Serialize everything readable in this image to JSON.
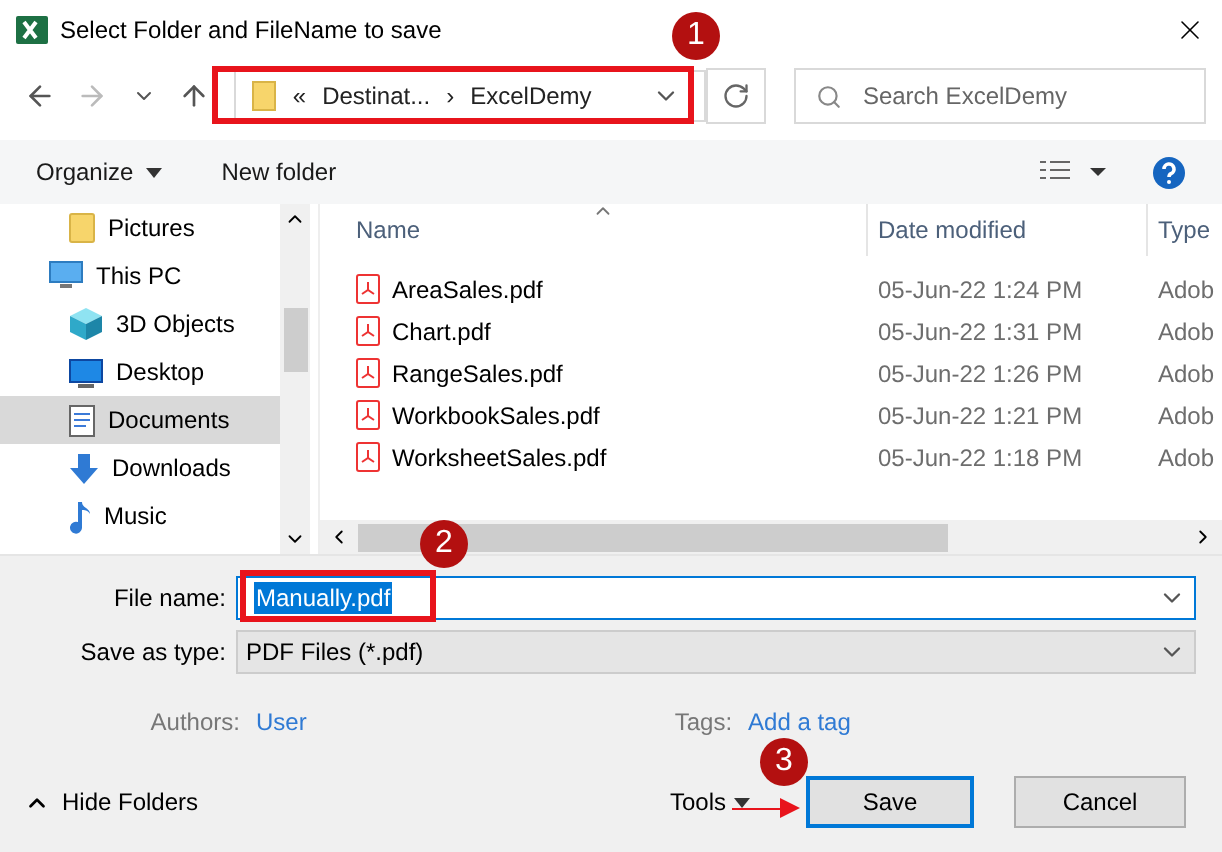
{
  "window": {
    "title": "Select Folder and FileName to save"
  },
  "address": {
    "overflow": "«",
    "segments": [
      "Destinat...",
      "ExcelDemy"
    ],
    "separator": "›"
  },
  "search": {
    "placeholder": "Search ExcelDemy"
  },
  "toolbar": {
    "organize": "Organize",
    "new_folder": "New folder"
  },
  "nav": [
    {
      "label": "Pictures",
      "kind": "folder",
      "selected": false
    },
    {
      "label": "This PC",
      "kind": "pc",
      "selected": false,
      "children": [
        {
          "label": "3D Objects",
          "kind": "cube",
          "selected": false
        },
        {
          "label": "Desktop",
          "kind": "desktop",
          "selected": false
        },
        {
          "label": "Documents",
          "kind": "document",
          "selected": true
        },
        {
          "label": "Downloads",
          "kind": "download",
          "selected": false
        },
        {
          "label": "Music",
          "kind": "music",
          "selected": false
        }
      ]
    }
  ],
  "columns": [
    "Name",
    "Date modified",
    "Type"
  ],
  "rows": [
    {
      "name": "AreaSales.pdf",
      "date": "05-Jun-22 1:24 PM",
      "type": "Adob"
    },
    {
      "name": "Chart.pdf",
      "date": "05-Jun-22 1:31 PM",
      "type": "Adob"
    },
    {
      "name": "RangeSales.pdf",
      "date": "05-Jun-22 1:26 PM",
      "type": "Adob"
    },
    {
      "name": "WorkbookSales.pdf",
      "date": "05-Jun-22 1:21 PM",
      "type": "Adob"
    },
    {
      "name": "WorksheetSales.pdf",
      "date": "05-Jun-22 1:18 PM",
      "type": "Adob"
    }
  ],
  "file_name": {
    "label": "File name:",
    "value": "Manually.pdf"
  },
  "save_type": {
    "label": "Save as type:",
    "value": "PDF Files (*.pdf)"
  },
  "authors": {
    "label": "Authors:",
    "value": "User"
  },
  "tags": {
    "label": "Tags:",
    "value": "Add a tag"
  },
  "footer": {
    "hide_folders": "Hide Folders",
    "tools": "Tools"
  },
  "buttons": [
    {
      "label": "Save",
      "default": true
    },
    {
      "label": "Cancel",
      "default": false
    }
  ],
  "annotations": [
    "1",
    "2",
    "3"
  ]
}
